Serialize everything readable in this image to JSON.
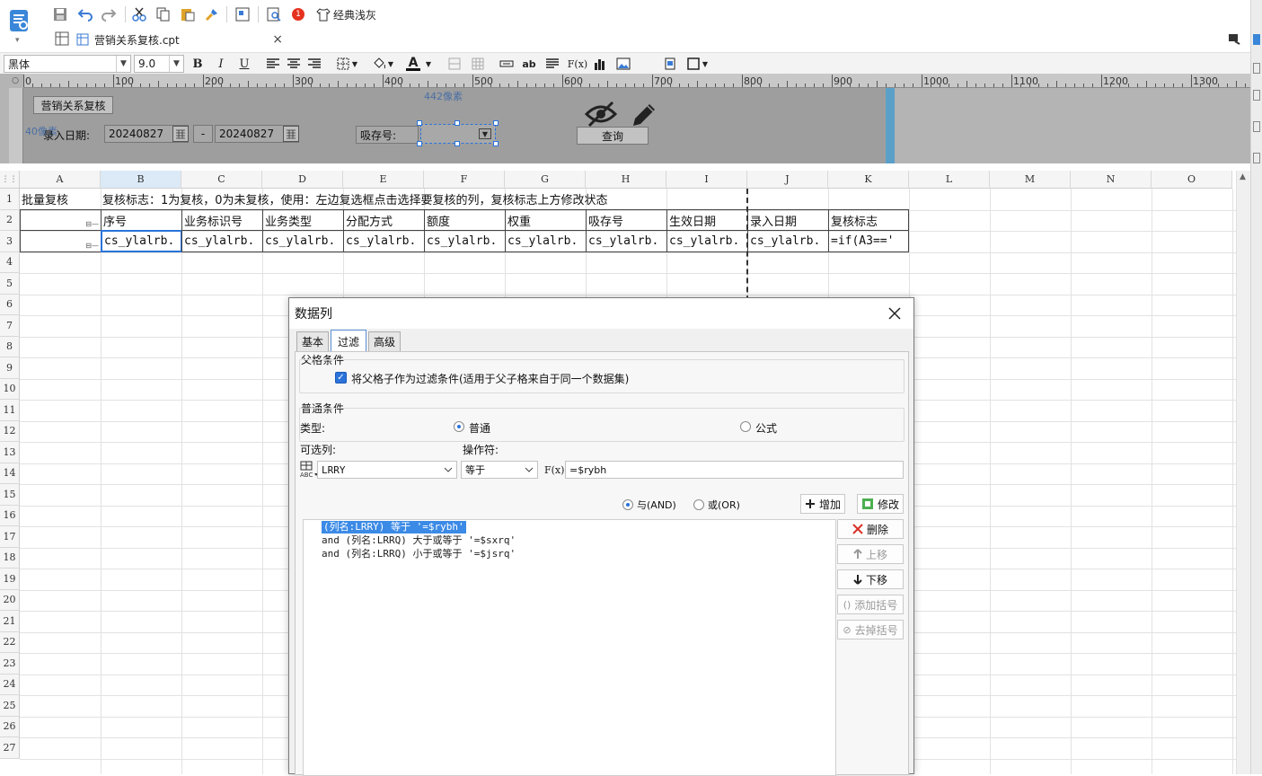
{
  "toolbar": {
    "theme_label": "经典浅灰",
    "notification_count": "1"
  },
  "file_tab": {
    "title": "营销关系复核.cpt",
    "close": "×"
  },
  "format_bar": {
    "font_name": "黑体",
    "font_size": "9.0",
    "bold": "B",
    "italic": "I",
    "underline": "U",
    "font_color_letter": "A",
    "ab_label": "ab",
    "fx_label": "F(x)"
  },
  "ruler": {
    "labels": [
      "0",
      "100",
      "200",
      "300",
      "400",
      "500",
      "600",
      "700",
      "800",
      "900",
      "1000",
      "1100",
      "1200",
      "1300"
    ],
    "px_hint_h": "442像素",
    "px_hint_v": "40像素"
  },
  "param_panel": {
    "title_button": "营销关系复核",
    "date_label": "录入日期:",
    "date_from": "20240827",
    "date_sep": "-",
    "date_to": "20240827",
    "deposit_label": "吸存号:",
    "query_button": "查询"
  },
  "sheet": {
    "columns": [
      "A",
      "B",
      "C",
      "D",
      "E",
      "F",
      "G",
      "H",
      "I",
      "J",
      "K",
      "L",
      "M",
      "N",
      "O"
    ],
    "rows": [
      "1",
      "2",
      "3",
      "4",
      "5",
      "6",
      "7",
      "8",
      "9",
      "10",
      "11",
      "12",
      "13",
      "14",
      "15",
      "16",
      "17",
      "18",
      "19",
      "20",
      "21",
      "22",
      "23",
      "24",
      "25",
      "26",
      "27"
    ],
    "row1": {
      "a": "批量复核",
      "b": "复核标志：1为复核，0为未复核，使用：左边复选框点击选择要复核的列，复核标志上方修改状态"
    },
    "row2": [
      "序号",
      "业务标识号",
      "业务类型",
      "分配方式",
      "额度",
      "权重",
      "吸存号",
      "生效日期",
      "录入日期",
      "复核标志"
    ],
    "row3": [
      "cs_ylalrb.",
      "cs_ylalrb.",
      "cs_ylalrb.",
      "cs_ylalrb.",
      "cs_ylalrb.",
      "cs_ylalrb.",
      "cs_ylalrb.",
      "cs_ylalrb.",
      "cs_ylalrb.",
      "=if(A3=='"
    ]
  },
  "dialog": {
    "title": "数据列",
    "tabs": [
      "基本",
      "过滤",
      "高级"
    ],
    "active_tab": "过滤",
    "parent_group_title": "父格条件",
    "parent_checkbox_label": "将父格子作为过滤条件(适用于父子格来自于同一个数据集)",
    "normal_group_title": "普通条件",
    "type_label": "类型:",
    "type_normal": "普通",
    "type_formula": "公式",
    "column_label": "可选列:",
    "operator_label": "操作符:",
    "column_value": "LRRY",
    "operator_value": "等于",
    "fx_label": "F(x)",
    "value": "=$rybh",
    "and_label": "与(AND)",
    "or_label": "或(OR)",
    "add_button": "增加",
    "modify_button": "修改",
    "delete_button": "删除",
    "up_button": "上移",
    "down_button": "下移",
    "add_paren_button": "添加括号",
    "remove_paren_button": "去掉括号",
    "conditions": [
      "(列名:LRRY) 等于 '=$rybh'",
      "and (列名:LRRQ) 大于或等于 '=$sxrq'",
      "and (列名:LRRQ) 小于或等于 '=$jsrq'"
    ]
  },
  "colors": {
    "accent": "#2b73d9",
    "selection": "#3b8ae6",
    "param_bg": "#9e9e9e",
    "delete_red": "#d93025",
    "notification_red": "#e5321e"
  }
}
